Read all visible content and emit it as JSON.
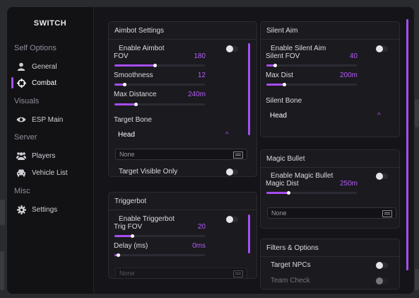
{
  "app": {
    "title": "SWITCH"
  },
  "colors": {
    "accent": "#a64ef0",
    "value": "#b45cf5",
    "background": "#121215"
  },
  "sidebar": {
    "sections": [
      {
        "label": "Self Options",
        "items": [
          {
            "label": "General",
            "icon": "user-icon"
          },
          {
            "label": "Combat",
            "icon": "crosshair-icon",
            "active": true
          }
        ]
      },
      {
        "label": "Visuals",
        "items": [
          {
            "label": "ESP Main",
            "icon": "eye-icon"
          }
        ]
      },
      {
        "label": "Server",
        "items": [
          {
            "label": "Players",
            "icon": "users-icon"
          },
          {
            "label": "Vehicle List",
            "icon": "car-icon"
          }
        ]
      },
      {
        "label": "Misc",
        "items": [
          {
            "label": "Settings",
            "icon": "gear-icon"
          }
        ]
      }
    ]
  },
  "aimbot": {
    "title": "Aimbot Settings",
    "enable_label": "Enable Aimbot",
    "enabled": false,
    "fov": {
      "label": "FOV",
      "value": "180",
      "fraction": 0.45
    },
    "smoothness": {
      "label": "Smoothness",
      "value": "12",
      "fraction": 0.12
    },
    "max_distance": {
      "label": "Max Distance",
      "value": "240m",
      "fraction": 0.24
    },
    "target_bone_label": "Target Bone",
    "target_bone_value": "Head",
    "search_value": "None",
    "target_visible_label": "Target Visible Only",
    "target_visible_enabled": false
  },
  "triggerbot": {
    "title": "Triggerbot",
    "enable_label": "Enable Triggerbot",
    "enabled": false,
    "fov": {
      "label": "Trig FOV",
      "value": "20",
      "fraction": 0.2
    },
    "delay": {
      "label": "Delay (ms)",
      "value": "0ms",
      "fraction": 0.05
    },
    "search_value": "None"
  },
  "silent_aim": {
    "title": "Silent Aim",
    "enable_label": "Enable Silent Aim",
    "enabled": false,
    "fov": {
      "label": "Silent FOV",
      "value": "40",
      "fraction": 0.1
    },
    "max_dist": {
      "label": "Max Dist",
      "value": "200m",
      "fraction": 0.2
    },
    "bone_label": "Silent Bone",
    "bone_value": "Head"
  },
  "magic_bullet": {
    "title": "Magic Bullet",
    "enable_label": "Enable Magic Bullet",
    "enabled": false,
    "dist": {
      "label": "Magic Dist",
      "value": "250m",
      "fraction": 0.25
    },
    "search_value": "None"
  },
  "filters": {
    "title": "Filters & Options",
    "target_npcs_label": "Target NPCs",
    "target_npcs_enabled": false,
    "team_check_label": "Team Check",
    "team_check_enabled": false
  }
}
